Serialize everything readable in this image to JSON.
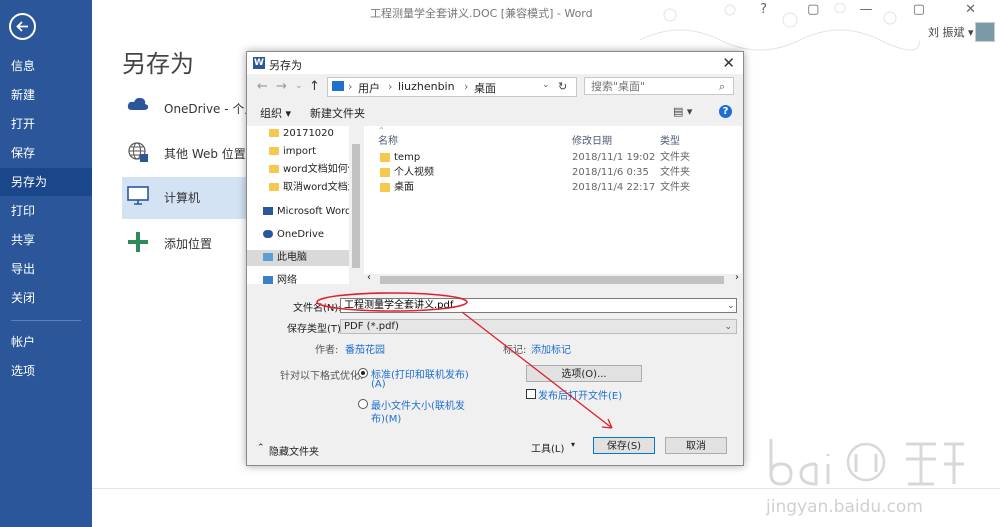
{
  "window": {
    "title": "工程测量学全套讲义.DOC [兼容模式] - Word",
    "user": "刘 振斌 ▾"
  },
  "sidebar": {
    "items": [
      {
        "label": "信息"
      },
      {
        "label": "新建"
      },
      {
        "label": "打开"
      },
      {
        "label": "保存"
      },
      {
        "label": "另存为",
        "active": true
      },
      {
        "label": "打印"
      },
      {
        "label": "共享"
      },
      {
        "label": "导出"
      },
      {
        "label": "关闭"
      },
      {
        "label": "帐户"
      },
      {
        "label": "选项"
      }
    ]
  },
  "saveas": {
    "title": "另存为",
    "places": [
      {
        "label": "OneDrive - 个人",
        "icon": "cloud-icon"
      },
      {
        "label": "其他 Web 位置",
        "icon": "globe-icon"
      },
      {
        "label": "计算机",
        "icon": "computer-icon",
        "active": true
      },
      {
        "label": "添加位置",
        "icon": "plus-icon"
      }
    ]
  },
  "dialog": {
    "title": "另存为",
    "breadcrumb": [
      "用户",
      "liuzhenbin",
      "桌面"
    ],
    "search_placeholder": "搜索\"桌面\"",
    "toolbar": {
      "organize": "组织 ▾",
      "new_folder": "新建文件夹"
    },
    "tree": [
      {
        "label": "20171020",
        "icon": "folder-icon"
      },
      {
        "label": "import",
        "icon": "folder-icon"
      },
      {
        "label": "word文档如何保",
        "icon": "folder-icon"
      },
      {
        "label": "取消word文档源",
        "icon": "folder-icon"
      },
      {
        "label": "Microsoft Word",
        "icon": "word-icon"
      },
      {
        "label": "OneDrive",
        "icon": "cloud-icon"
      },
      {
        "label": "此电脑",
        "icon": "computer-icon",
        "selected": true
      },
      {
        "label": "网络",
        "icon": "network-icon"
      }
    ],
    "columns": {
      "name": "名称",
      "date": "修改日期",
      "type": "类型"
    },
    "files": [
      {
        "name": "temp",
        "date": "2018/11/1 19:02",
        "type": "文件夹"
      },
      {
        "name": "个人视频",
        "date": "2018/11/6 0:35",
        "type": "文件夹"
      },
      {
        "name": "桌面",
        "date": "2018/11/4 22:17",
        "type": "文件夹"
      }
    ],
    "form": {
      "filename_label": "文件名(N):",
      "filename_value": "工程测量学全套讲义.pdf",
      "filetype_label": "保存类型(T):",
      "filetype_value": "PDF (*.pdf)",
      "author_label": "作者:",
      "author_value": "番茄花园",
      "tags_label": "标记:",
      "tags_value": "添加标记",
      "optimize_label": "针对以下格式优化:",
      "opt_standard_1": "标准(打印和联机发布)",
      "opt_standard_2": "(A)",
      "opt_min_1": "最小文件大小(联机发",
      "opt_min_2": "布)(M)",
      "options_btn": "选项(O)...",
      "open_after": "发布后打开文件(E)",
      "hide_folders": "隐藏文件夹",
      "tools": "工具(L)",
      "save_btn": "保存(S)",
      "cancel_btn": "取消"
    }
  },
  "watermark": {
    "text": "jingyan.baidu.com"
  },
  "colors": {
    "sidebar": "#2b579a",
    "sidebar_active": "#19478a",
    "annotation": "#e0202a",
    "link": "#1e6fd0"
  }
}
